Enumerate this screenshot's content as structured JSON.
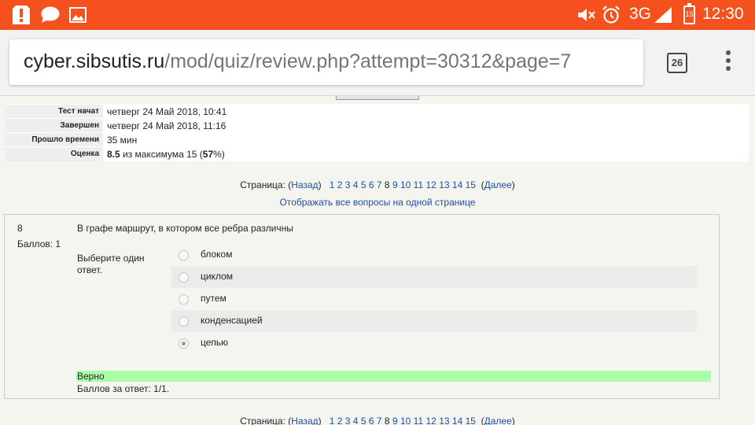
{
  "status_bar": {
    "network": "3G",
    "battery_level": "15",
    "time": "12:30",
    "bg_color": "#f4511e"
  },
  "address_bar": {
    "host": "cyber.sibsutis.ru",
    "path": "/mod/quiz/review.php?attempt=30312&page=7",
    "tab_count": "26"
  },
  "summary": {
    "rows": [
      {
        "label": "Тест начат",
        "value": "четверг 24 Май 2018, 10:41"
      },
      {
        "label": "Завершен",
        "value": "четверг 24 Май 2018, 11:16"
      },
      {
        "label": "Прошло времени",
        "value": "35 мин"
      }
    ],
    "grade": {
      "label": "Оценка",
      "score": "8.5",
      "middle": " из максимума 15 (",
      "percent": "57",
      "end": "%)"
    }
  },
  "paging": {
    "prefix": "Страница: (",
    "prev": "Назад",
    "mid": ")",
    "pages": [
      "1",
      "2",
      "3",
      "4",
      "5",
      "6",
      "7",
      "8",
      "9",
      "10",
      "11",
      "12",
      "13",
      "14",
      "15"
    ],
    "current": "8",
    "open": "(",
    "next": "Далее",
    "close": ")"
  },
  "show_all_link": "Отображать все вопросы на одной странице",
  "question": {
    "number": "8",
    "grade_label": "Баллов: 1",
    "text": "В графе маршрут, в котором все ребра различны",
    "prompt": "Выберите один ответ.",
    "options": [
      {
        "label": "блоком",
        "checked": false
      },
      {
        "label": "циклом",
        "checked": false
      },
      {
        "label": "путем",
        "checked": false
      },
      {
        "label": "конденсацией",
        "checked": false
      },
      {
        "label": "цепью",
        "checked": true
      }
    ],
    "feedback": "Верно",
    "feedback_color": "#aaffaa",
    "score_text": "Баллов за ответ: 1/1."
  }
}
